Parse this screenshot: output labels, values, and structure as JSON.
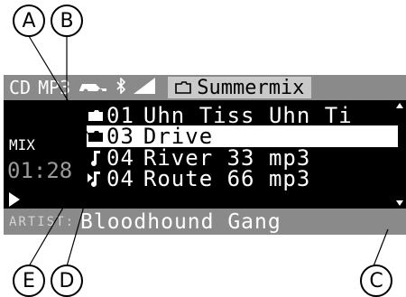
{
  "callouts": {
    "a": "A",
    "b": "B",
    "c": "C",
    "d": "D",
    "e": "E"
  },
  "status_bar": {
    "source": "CD",
    "format": "MP3",
    "folder_name": "Summermix"
  },
  "side": {
    "mode": "MIX",
    "elapsed": "01:28"
  },
  "list": {
    "items": [
      {
        "num": "01",
        "title": "Uhn Tiss Uhn Ti",
        "icon": "folder-icon"
      },
      {
        "num": "03",
        "title": "Drive",
        "icon": "folder-icon",
        "selected": true
      },
      {
        "num": "04",
        "title": "River 33 mp3",
        "icon": "music-note-icon"
      },
      {
        "num": "04",
        "title": "Route 66 mp3",
        "icon": "music-note-playing-icon"
      }
    ]
  },
  "artist_bar": {
    "label": "ARTIST:",
    "value": "Bloodhound Gang"
  }
}
